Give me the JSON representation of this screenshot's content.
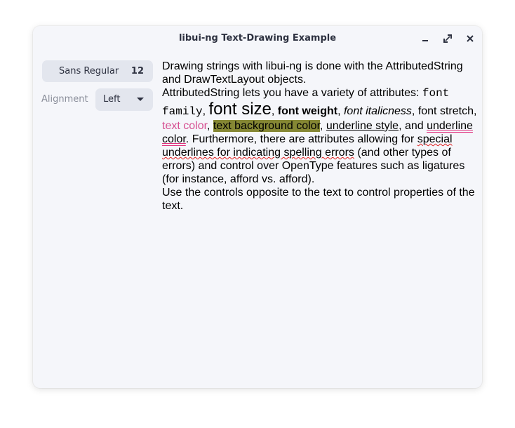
{
  "window": {
    "title": "libui-ng Text-Drawing Example"
  },
  "titlebar": {
    "minimize_icon": "minimize-icon",
    "maximize_icon": "maximize-icon",
    "close_icon": "close-icon"
  },
  "controls": {
    "font_name": "Sans Regular",
    "font_size": "12",
    "alignment_label": "Alignment",
    "alignment_value": "Left"
  },
  "text": {
    "line1": "Drawing strings with libui-ng is done with the AttributedString",
    "line2": "and DrawTextLayout objects.",
    "line3_prefix": "AttributedString lets you have a variety of attributes: ",
    "font_family_part1": "font",
    "font_family_part2": "family",
    "comma1": ", ",
    "font_size_text": "font size",
    "comma2": ", ",
    "font_weight_text": "font weight",
    "comma3": ", ",
    "italic_text": "font italicness",
    "stretch_text": ", font stretch,",
    "text_color": "text color",
    "comma4": ", ",
    "bg_color": "text background color",
    "comma5": ", ",
    "underline_style": "underline style",
    "and_text": ", and ",
    "underline_color_a": "underline",
    "underline_color_b": "color",
    "line6_rest": ". Furthermore, there are attributes allowing for ",
    "special": "special",
    "spelling_line": "underlines for indicating spelling errors",
    "line7_rest": " (and other types of",
    "line8": "errors) and control over OpenType features such as ligatures",
    "line9": "(for instance, afford vs. afford).",
    "line10": "Use the controls opposite to the text to control properties of the",
    "line11": "text."
  },
  "colors": {
    "text_color": "#d64f91",
    "background_color": "#858734",
    "underline_color": "#e0307c",
    "spelling_error": "#e12121"
  }
}
